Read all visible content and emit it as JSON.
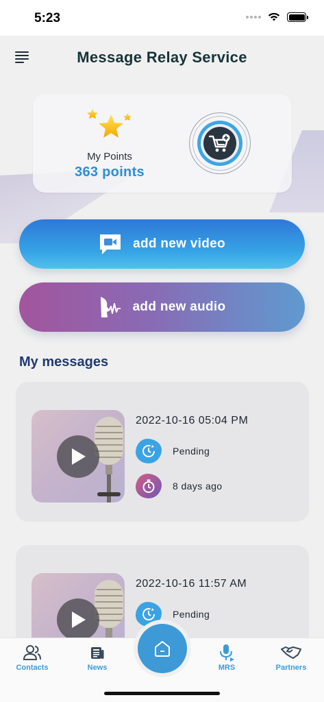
{
  "status_bar": {
    "time": "5:23"
  },
  "header": {
    "title": "Message Relay Service"
  },
  "points": {
    "label": "My Points",
    "value": "363 points"
  },
  "actions": {
    "video_label": "add new video",
    "audio_label": "add new audio"
  },
  "messages": {
    "title": "My messages",
    "items": [
      {
        "date": "2022-10-16 05:04 PM",
        "status": "Pending",
        "age": "8 days ago"
      },
      {
        "date": "2022-10-16 11:57 AM",
        "status": "Pending"
      }
    ]
  },
  "nav": {
    "contacts": "Contacts",
    "news": "News",
    "mrs": "MRS",
    "partners": "Partners"
  },
  "colors": {
    "accent": "#3d9ad6",
    "points_value": "#2b8fd8",
    "section_title": "#1f3a72"
  },
  "icons": {
    "menu": "menu-icon",
    "cart": "cart-plus-icon",
    "video": "video-chat-icon",
    "audio": "voice-wave-icon",
    "play": "play-icon",
    "pending": "clock-refresh-icon",
    "age": "stopwatch-icon",
    "home": "home-icon"
  }
}
